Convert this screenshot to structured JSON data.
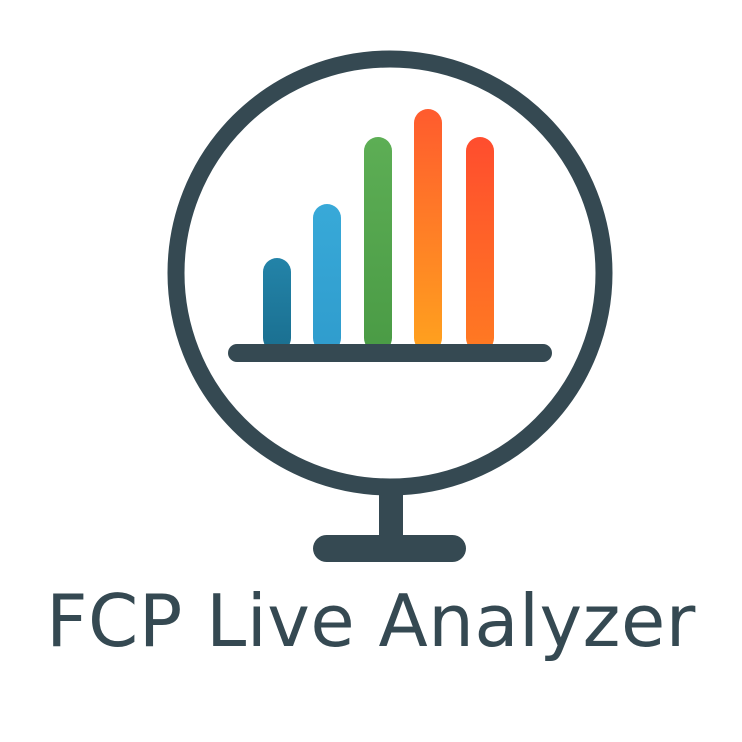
{
  "logo": {
    "name": "FCP Live Analyzer",
    "colors": {
      "frame": "#354952",
      "bar1_top": "#2383a8",
      "bar1_bottom": "#1a6f90",
      "bar2_top": "#38a9d8",
      "bar2_bottom": "#2f9ccd",
      "bar3_top": "#5dae55",
      "bar3_bottom": "#4a9b45",
      "bar4_top": "#ff5b2e",
      "bar4_bottom": "#ffa21e",
      "bar5_top": "#ff4d2e",
      "bar5_bottom": "#ff7a22"
    },
    "bars": [
      {
        "id": "bar-1",
        "level": 0.37
      },
      {
        "id": "bar-2",
        "level": 0.6
      },
      {
        "id": "bar-3",
        "level": 0.88
      },
      {
        "id": "bar-4",
        "level": 1.0
      },
      {
        "id": "bar-5",
        "level": 0.88
      }
    ]
  }
}
